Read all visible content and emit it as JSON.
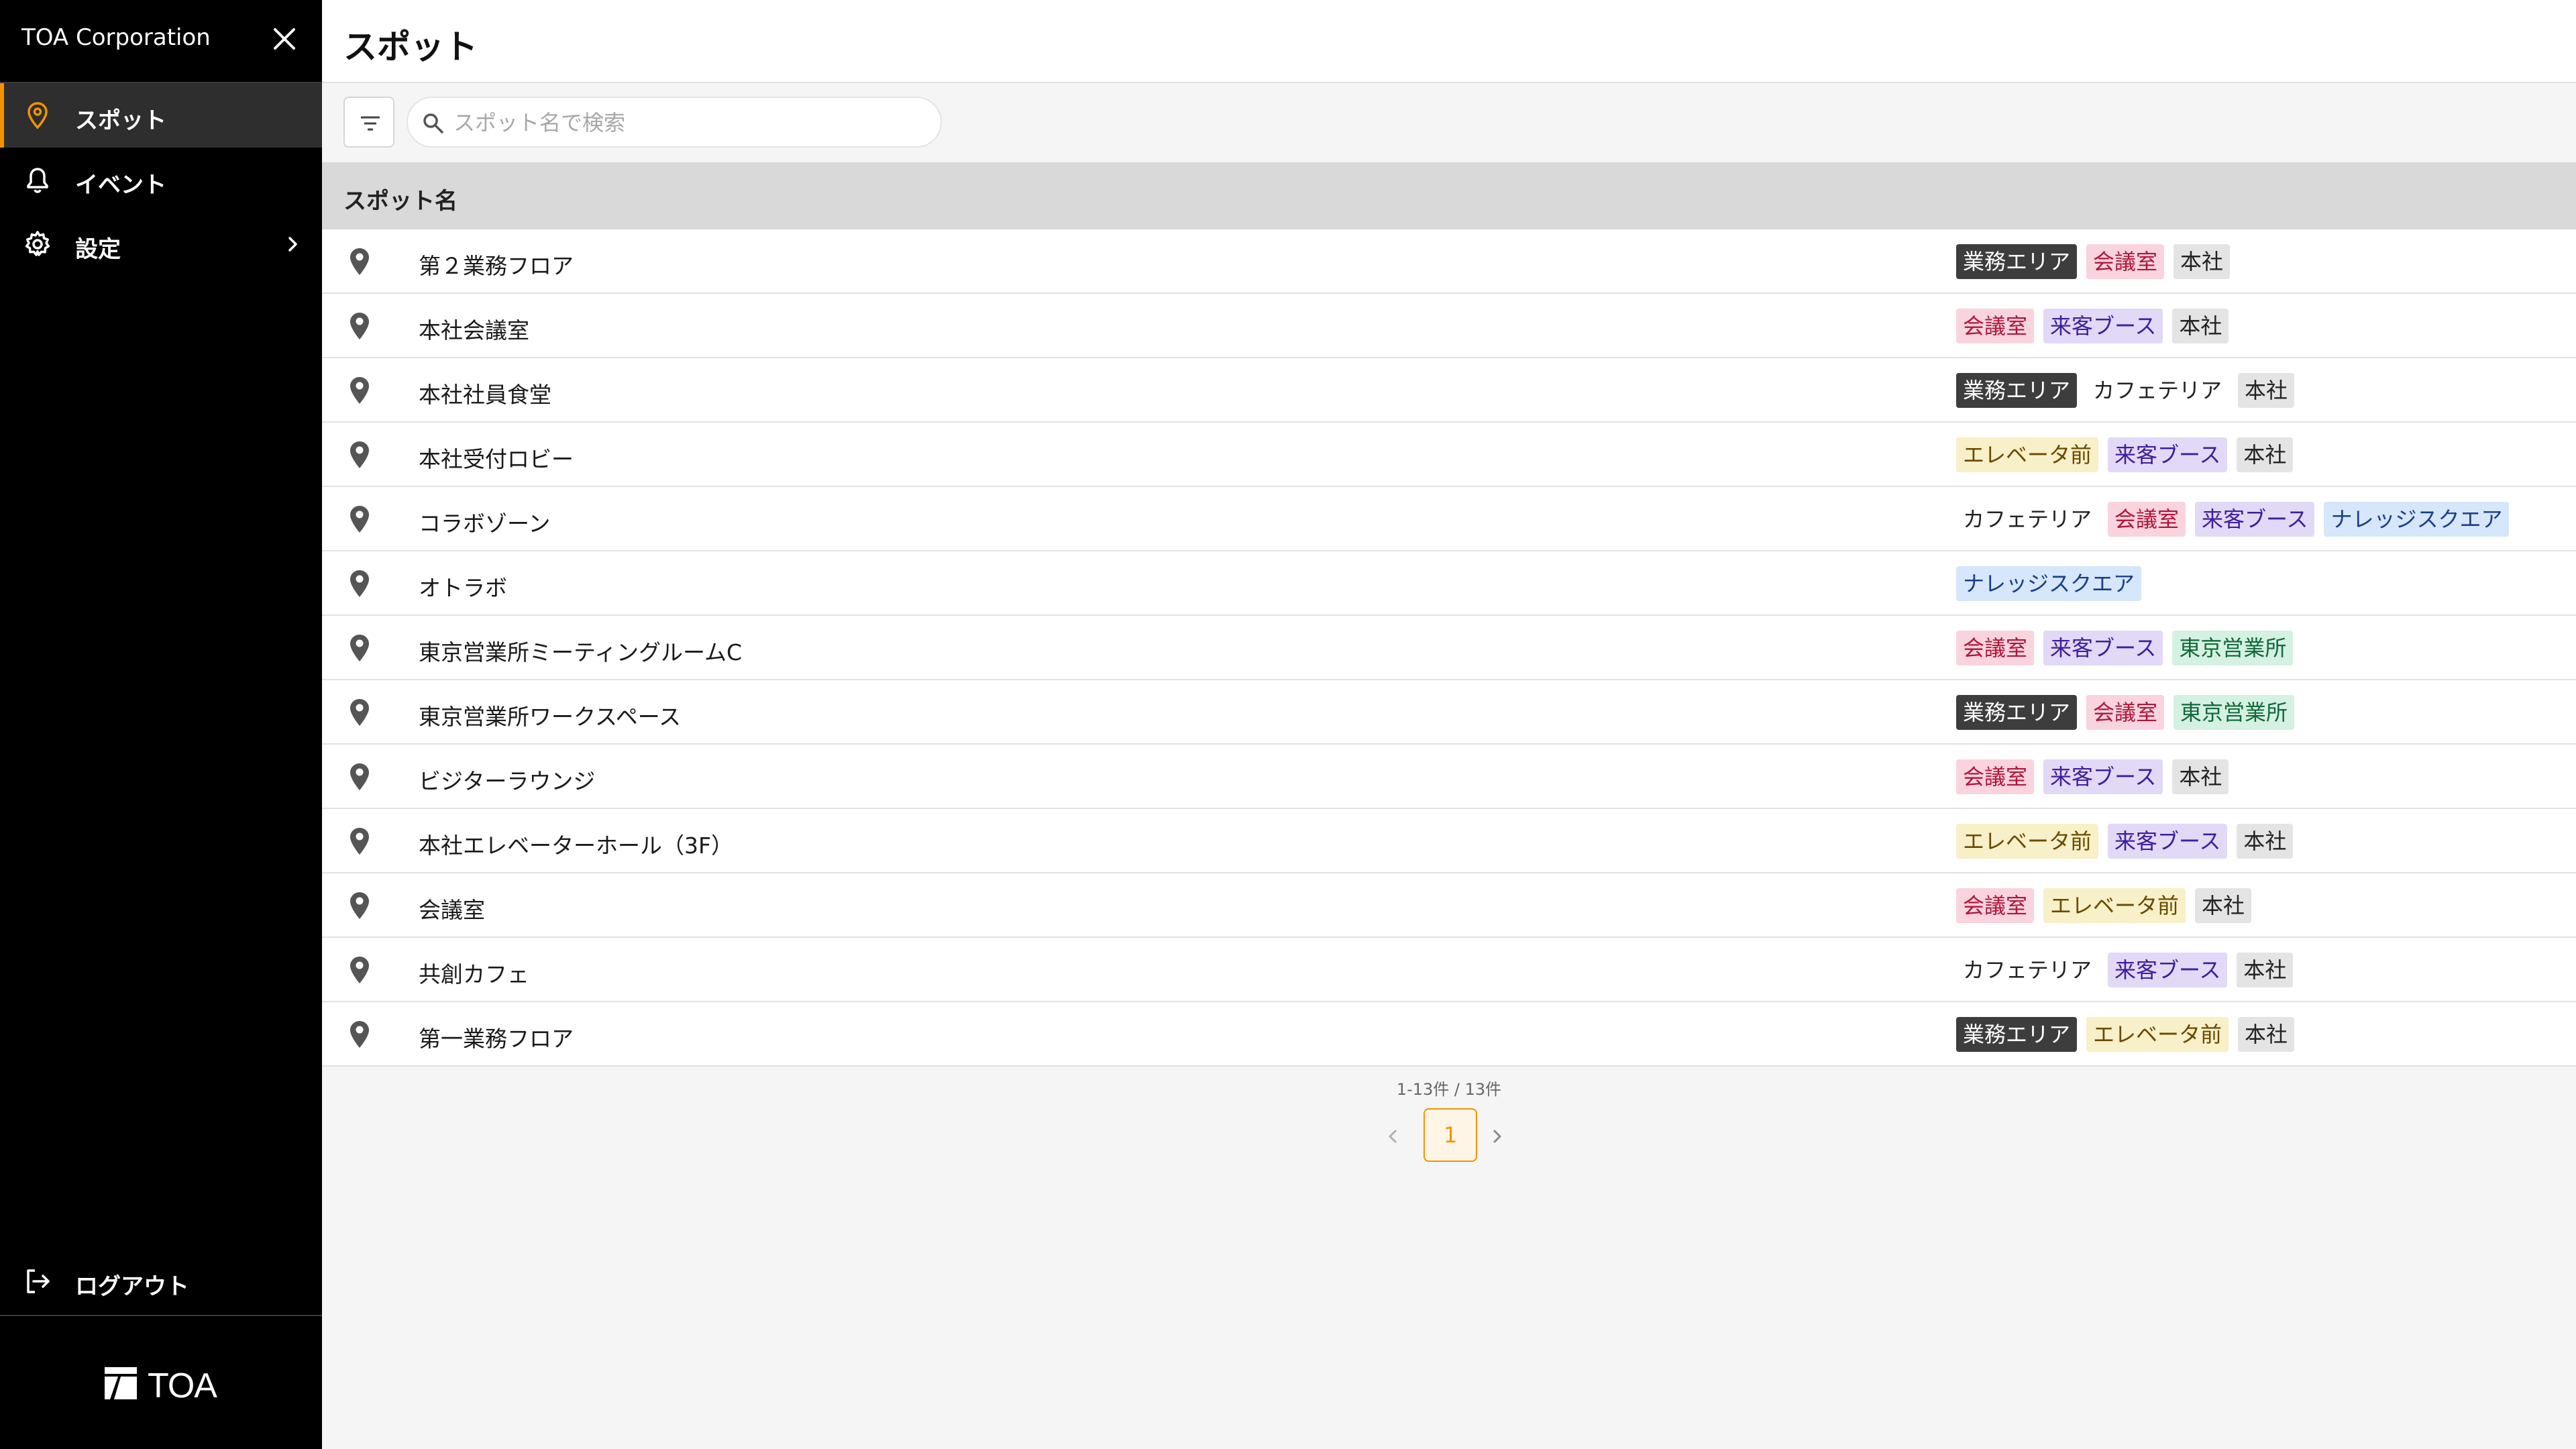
{
  "colors": {
    "accent": "#f39200",
    "sidebar_bg": "#000000",
    "tag_styles": {
      "業務エリア": {
        "bg": "#3d3d3d",
        "fg": "#ffffff"
      },
      "会議室": {
        "bg": "#f9d4de",
        "fg": "#b0153a"
      },
      "本社": {
        "bg": "#e4e4e4",
        "fg": "#222222"
      },
      "来客ブース": {
        "bg": "#e2d9f7",
        "fg": "#3b1f9e"
      },
      "カフェテリア": {
        "bg": "#ffffff",
        "fg": "#222222"
      },
      "エレベータ前": {
        "bg": "#f8f0c8",
        "fg": "#6a4a00"
      },
      "ナレッジスクエア": {
        "bg": "#d6e6fb",
        "fg": "#1a3f86"
      },
      "東京営業所": {
        "bg": "#d4f1e1",
        "fg": "#11683b"
      }
    }
  },
  "sidebar": {
    "company": "TOA Corporation",
    "close_icon": "close-icon",
    "items": [
      {
        "label": "スポット",
        "icon": "location-pin-icon",
        "active": true
      },
      {
        "label": "イベント",
        "icon": "bell-icon",
        "active": false
      },
      {
        "label": "設定",
        "icon": "gear-icon",
        "active": false,
        "has_submenu": true
      }
    ],
    "logout_label": "ログアウト",
    "logo_text": "TOA"
  },
  "header": {
    "title": "スポット"
  },
  "toolbar": {
    "filter_icon": "filter-icon",
    "search_placeholder": "スポット名で検索",
    "search_value": ""
  },
  "table": {
    "column_header": "スポット名",
    "rows": [
      {
        "name": "第２業務フロア",
        "tags": [
          "業務エリア",
          "会議室",
          "本社"
        ]
      },
      {
        "name": "本社会議室",
        "tags": [
          "会議室",
          "来客ブース",
          "本社"
        ]
      },
      {
        "name": "本社社員食堂",
        "tags": [
          "業務エリア",
          "カフェテリア",
          "本社"
        ]
      },
      {
        "name": "本社受付ロビー",
        "tags": [
          "エレベータ前",
          "来客ブース",
          "本社"
        ]
      },
      {
        "name": "コラボゾーン",
        "tags": [
          "カフェテリア",
          "会議室",
          "来客ブース",
          "ナレッジスクエア"
        ]
      },
      {
        "name": "オトラボ",
        "tags": [
          "ナレッジスクエア"
        ]
      },
      {
        "name": "東京営業所ミーティングルームC",
        "tags": [
          "会議室",
          "来客ブース",
          "東京営業所"
        ]
      },
      {
        "name": "東京営業所ワークスペース",
        "tags": [
          "業務エリア",
          "会議室",
          "東京営業所"
        ]
      },
      {
        "name": "ビジターラウンジ",
        "tags": [
          "会議室",
          "来客ブース",
          "本社"
        ]
      },
      {
        "name": "本社エレベーターホール（3F）",
        "tags": [
          "エレベータ前",
          "来客ブース",
          "本社"
        ]
      },
      {
        "name": "会議室",
        "tags": [
          "会議室",
          "エレベータ前",
          "本社"
        ]
      },
      {
        "name": "共創カフェ",
        "tags": [
          "カフェテリア",
          "来客ブース",
          "本社"
        ]
      },
      {
        "name": "第一業務フロア",
        "tags": [
          "業務エリア",
          "エレベータ前",
          "本社"
        ]
      }
    ]
  },
  "pagination": {
    "summary": "1-13件 / 13件",
    "current_page": "1"
  }
}
